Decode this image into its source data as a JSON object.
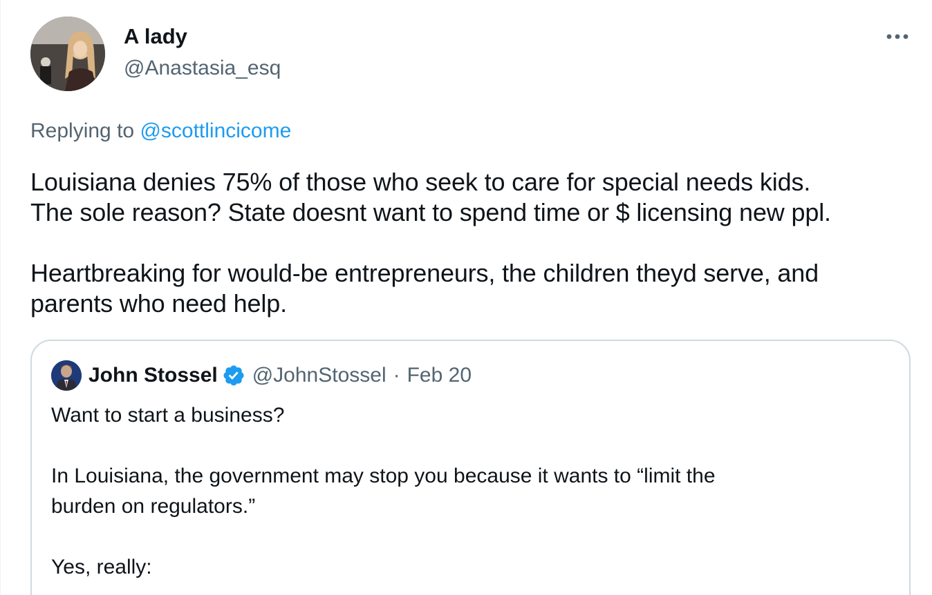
{
  "author": {
    "display_name": "A lady",
    "handle": "@Anastasia_esq",
    "avatar_icon": "profile-photo"
  },
  "more_icon": "more-horizontal-icon",
  "reply_context": {
    "prefix": "Replying to ",
    "mention": "@scottlincicome"
  },
  "tweet": {
    "lines": [
      "Louisiana denies 75% of those who seek to care for special needs kids.",
      "The sole reason? State doesnt want to spend time or $ licensing new ppl.",
      "Heartbreaking for would-be entrepreneurs, the children theyd serve, and",
      "parents who need help."
    ]
  },
  "quoted_tweet": {
    "display_name": "John Stossel",
    "verified_icon": "verified-badge-icon",
    "handle": "@JohnStossel",
    "separator": "·",
    "date": "Feb 20",
    "lines": [
      "Want to start a business?",
      "In Louisiana, the government may stop you because it wants to “limit the",
      "burden on regulators.”",
      "Yes, really:"
    ]
  },
  "colors": {
    "text_primary": "#0f1419",
    "text_secondary": "#536471",
    "accent": "#1d9bf0",
    "border": "#cfd9de"
  }
}
